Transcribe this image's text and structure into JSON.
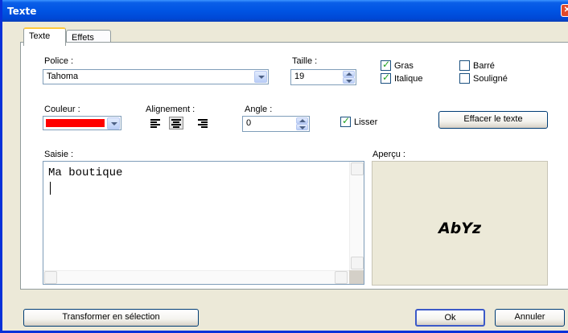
{
  "window": {
    "title": "Texte"
  },
  "tabs": [
    {
      "label": "Texte"
    },
    {
      "label": "Effets"
    }
  ],
  "font": {
    "label": "Police :",
    "value": "Tahoma"
  },
  "size": {
    "label": "Taille :",
    "value": "19"
  },
  "styles": {
    "bold": {
      "label": "Gras",
      "checked": true
    },
    "italic": {
      "label": "Italique",
      "checked": true
    },
    "strike": {
      "label": "Barré",
      "checked": false
    },
    "underline": {
      "label": "Souligné",
      "checked": false
    }
  },
  "color": {
    "label": "Couleur :",
    "value": "#ff0000"
  },
  "alignment": {
    "label": "Alignement :",
    "options": [
      "left",
      "center",
      "right"
    ],
    "selected": "center"
  },
  "angle": {
    "label": "Angle :",
    "value": "0"
  },
  "smooth": {
    "label": "Lisser",
    "checked": true
  },
  "clear_button": "Effacer le texte",
  "input": {
    "label": "Saisie :",
    "text": "Ma boutique"
  },
  "preview": {
    "label": "Aperçu :",
    "sample": "AbYz"
  },
  "footer": {
    "convert_button": "Transformer en sélection",
    "ok_button": "Ok",
    "cancel_button": "Annuler"
  }
}
